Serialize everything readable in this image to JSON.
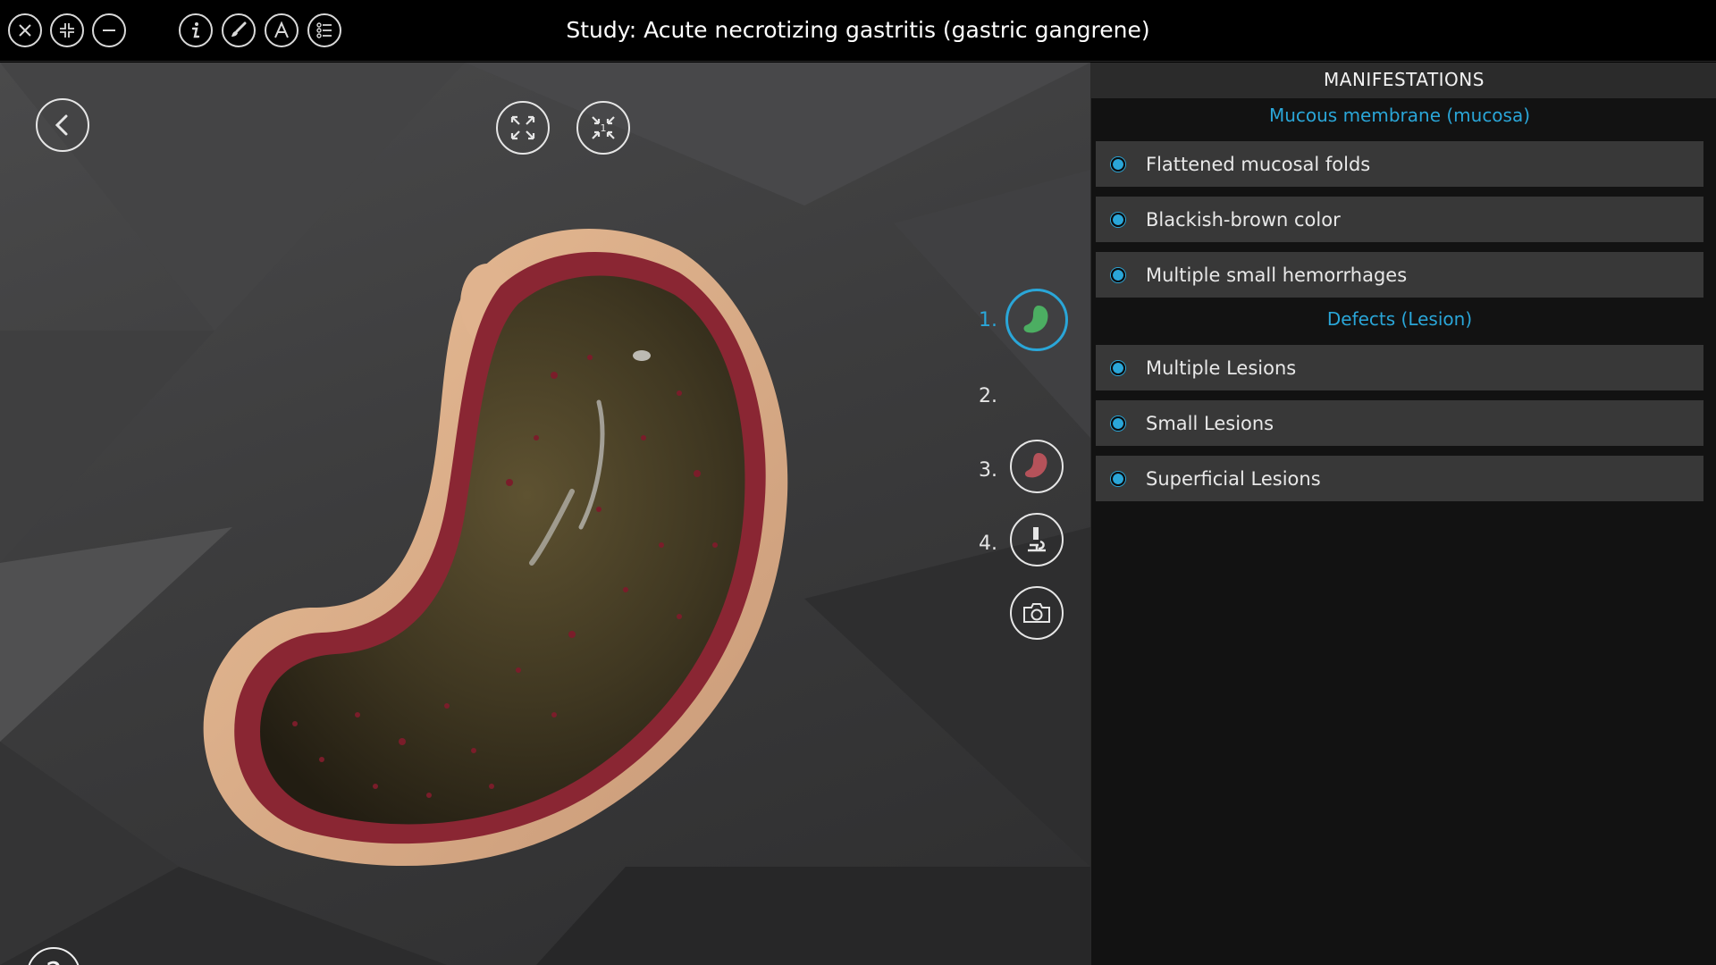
{
  "app": {
    "title": "Study: Acute necrotizing gastritis (gastric gangrene)"
  },
  "topbar": {
    "left_buttons": [
      "close-icon",
      "compress-icon",
      "minimize-icon"
    ],
    "tool_buttons": [
      "info-icon",
      "brush-icon",
      "text-a-icon",
      "list-icon"
    ]
  },
  "viewport": {
    "nav_buttons": [
      "back-icon",
      "expand-icon",
      "collapse-1-icon"
    ],
    "collapse_badge": "1",
    "views": [
      {
        "number": "1.",
        "icon": "stomach-green-icon",
        "active": true
      },
      {
        "number": "2.",
        "icon": "stomach-red-icon",
        "active": false
      },
      {
        "number": "3.",
        "icon": "microscope-icon",
        "active": false
      },
      {
        "number": "4.",
        "icon": "camera-icon",
        "active": false
      }
    ],
    "help_label": "?"
  },
  "panel": {
    "header": "MANIFESTATIONS",
    "sections": [
      {
        "title": "Mucous membrane (mucosa)",
        "items": [
          "Flattened mucosal folds",
          "Blackish-brown color",
          "Multiple small hemorrhages"
        ]
      },
      {
        "title": "Defects (Lesion)",
        "items": [
          "Multiple Lesions",
          "Small Lesions",
          "Superficial Lesions"
        ]
      }
    ]
  },
  "colors": {
    "accent": "#2aa6d8",
    "panel_bg": "#121212",
    "item_bg": "#383838",
    "header_bg": "#2b2b2b"
  }
}
